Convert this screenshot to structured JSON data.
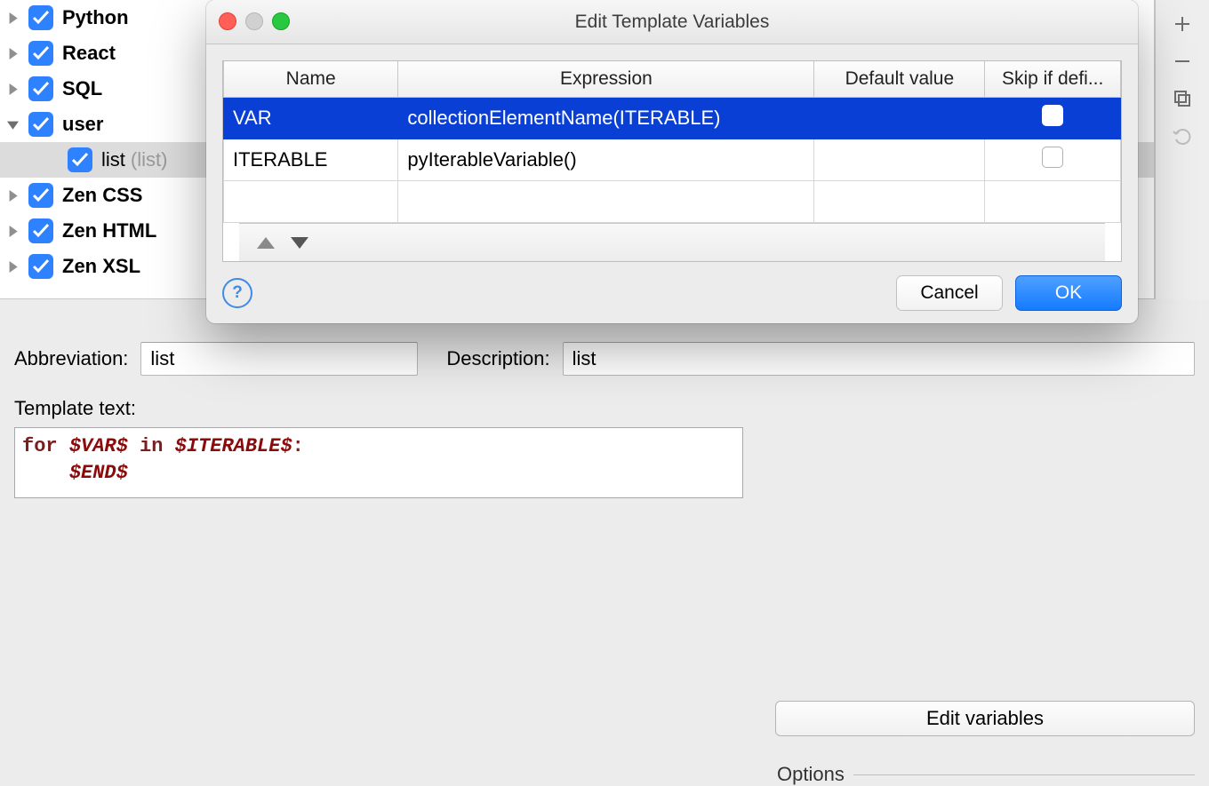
{
  "tree": {
    "items": [
      {
        "label": "Python",
        "expanded": false
      },
      {
        "label": "React",
        "expanded": false
      },
      {
        "label": "SQL",
        "expanded": false
      },
      {
        "label": "user",
        "expanded": true,
        "children": [
          {
            "label": "list",
            "suffix": "(list)"
          }
        ]
      },
      {
        "label": "Zen CSS",
        "expanded": false
      },
      {
        "label": "Zen HTML",
        "expanded": false
      },
      {
        "label": "Zen XSL",
        "expanded": false
      }
    ]
  },
  "form": {
    "abbreviation_label": "Abbreviation:",
    "abbreviation_value": "list",
    "description_label": "Description:",
    "description_value": "list",
    "template_label": "Template text:",
    "template_tokens": {
      "kw_for": "for",
      "var1": "$VAR$",
      "kw_in": "in",
      "var2": "$ITERABLE$",
      "colon": ":",
      "var3": "$END$"
    },
    "edit_variables_button": "Edit variables",
    "options_label": "Options"
  },
  "dialog": {
    "title": "Edit Template Variables",
    "columns": {
      "name": "Name",
      "expression": "Expression",
      "default": "Default value",
      "skip": "Skip if defi..."
    },
    "rows": [
      {
        "name": "VAR",
        "expression": "collectionElementName(ITERABLE)",
        "default": "",
        "skip": false,
        "selected": true
      },
      {
        "name": "ITERABLE",
        "expression": "pyIterableVariable()",
        "default": "",
        "skip": false,
        "selected": false
      }
    ],
    "cancel": "Cancel",
    "ok": "OK"
  }
}
